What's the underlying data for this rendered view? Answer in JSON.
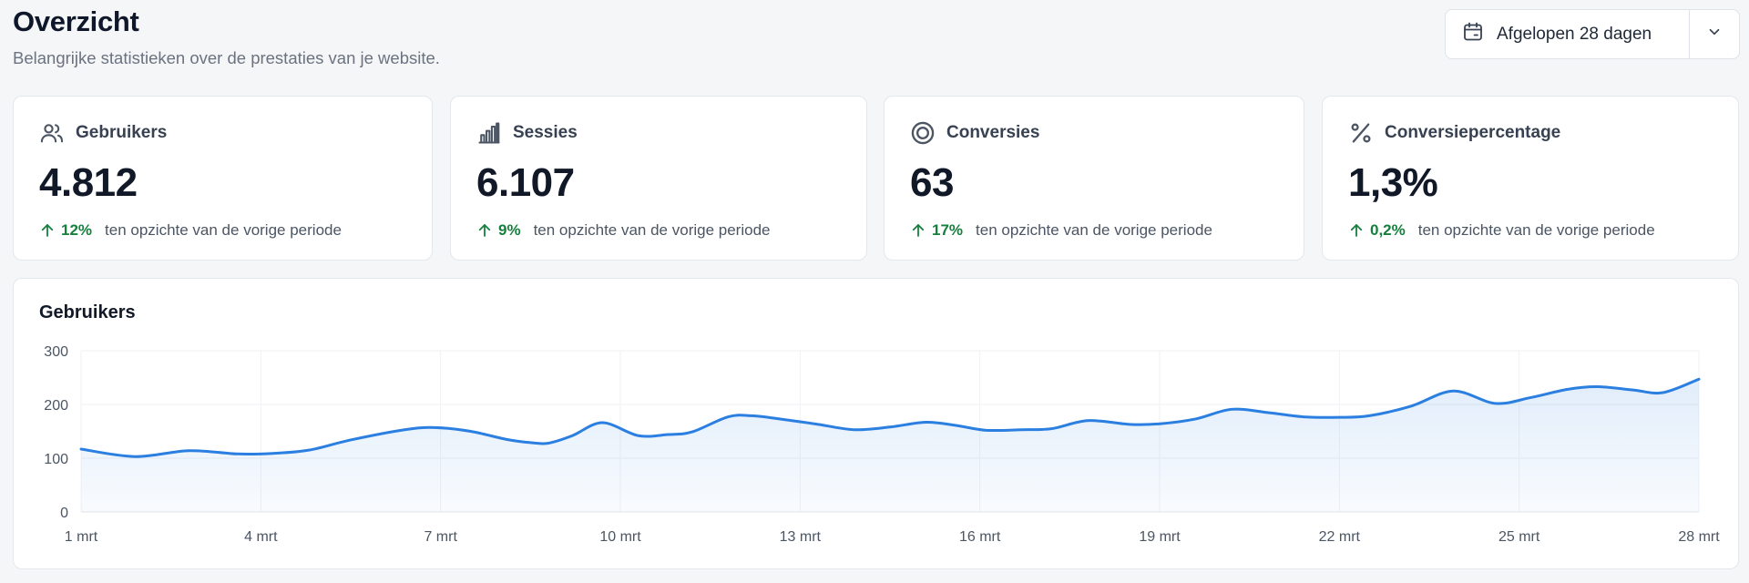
{
  "header": {
    "title": "Overzicht",
    "subtitle": "Belangrijke statistieken over de prestaties van je website."
  },
  "date_range": {
    "label": "Afgelopen 28 dagen",
    "icon": "calendar-icon",
    "toggle_icon": "chevron-down-icon"
  },
  "stats": [
    {
      "label": "Gebruikers",
      "icon": "users-icon",
      "value": "4.812",
      "change": "12%",
      "change_text": "ten opzichte van de vorige periode"
    },
    {
      "label": "Sessies",
      "icon": "bar-chart-icon",
      "value": "6.107",
      "change": "9%",
      "change_text": "ten opzichte van de vorige periode"
    },
    {
      "label": "Conversies",
      "icon": "target-icon",
      "value": "63",
      "change": "17%",
      "change_text": "ten opzichte van de vorige periode"
    },
    {
      "label": "Conversiepercentage",
      "icon": "percent-icon",
      "value": "1,3%",
      "change": "0,2%",
      "change_text": "ten opzichte van de vorige periode"
    }
  ],
  "colors": {
    "accent": "#2b7fe0",
    "positive": "#15803d",
    "background": "#f5f6f8"
  },
  "chart": {
    "title": "Gebruikers"
  },
  "chart_data": {
    "type": "area",
    "title": "Gebruikers",
    "xlabel": "",
    "ylabel": "",
    "ylim": [
      0,
      300
    ],
    "yticks": [
      0,
      100,
      200,
      300
    ],
    "grid": true,
    "x_tick_labels": [
      "1 mrt",
      "4 mrt",
      "7 mrt",
      "10 mrt",
      "13 mrt",
      "16 mrt",
      "19 mrt",
      "22 mrt",
      "25 mrt",
      "28 mrt"
    ],
    "series": [
      {
        "x": [
          1,
          1.9,
          2.8,
          3.6,
          4.2,
          4.8,
          5.5,
          6.4,
          6.9,
          7.5,
          8.1,
          8.5,
          8.8,
          9.2,
          9.7,
          10.3,
          10.8,
          11.2,
          11.8,
          12.2,
          12.6,
          13.3,
          13.9,
          14.5,
          15.1,
          15.6,
          16.1,
          16.7,
          17.2,
          17.8,
          18.5,
          19.0,
          19.6,
          20.2,
          20.8,
          21.4,
          22.0,
          22.5,
          23.2,
          23.9,
          24.6,
          25.2,
          25.8,
          26.3,
          26.9,
          27.4,
          28
        ],
        "y": [
          117,
          103,
          114,
          108,
          109,
          115,
          134,
          153,
          157,
          150,
          135,
          129,
          128,
          142,
          166,
          142,
          144,
          149,
          177,
          179,
          174,
          163,
          153,
          158,
          167,
          161,
          152,
          153,
          155,
          170,
          163,
          164,
          173,
          191,
          185,
          177,
          176,
          179,
          197,
          225,
          202,
          213,
          228,
          233,
          227,
          222,
          247
        ]
      }
    ]
  }
}
